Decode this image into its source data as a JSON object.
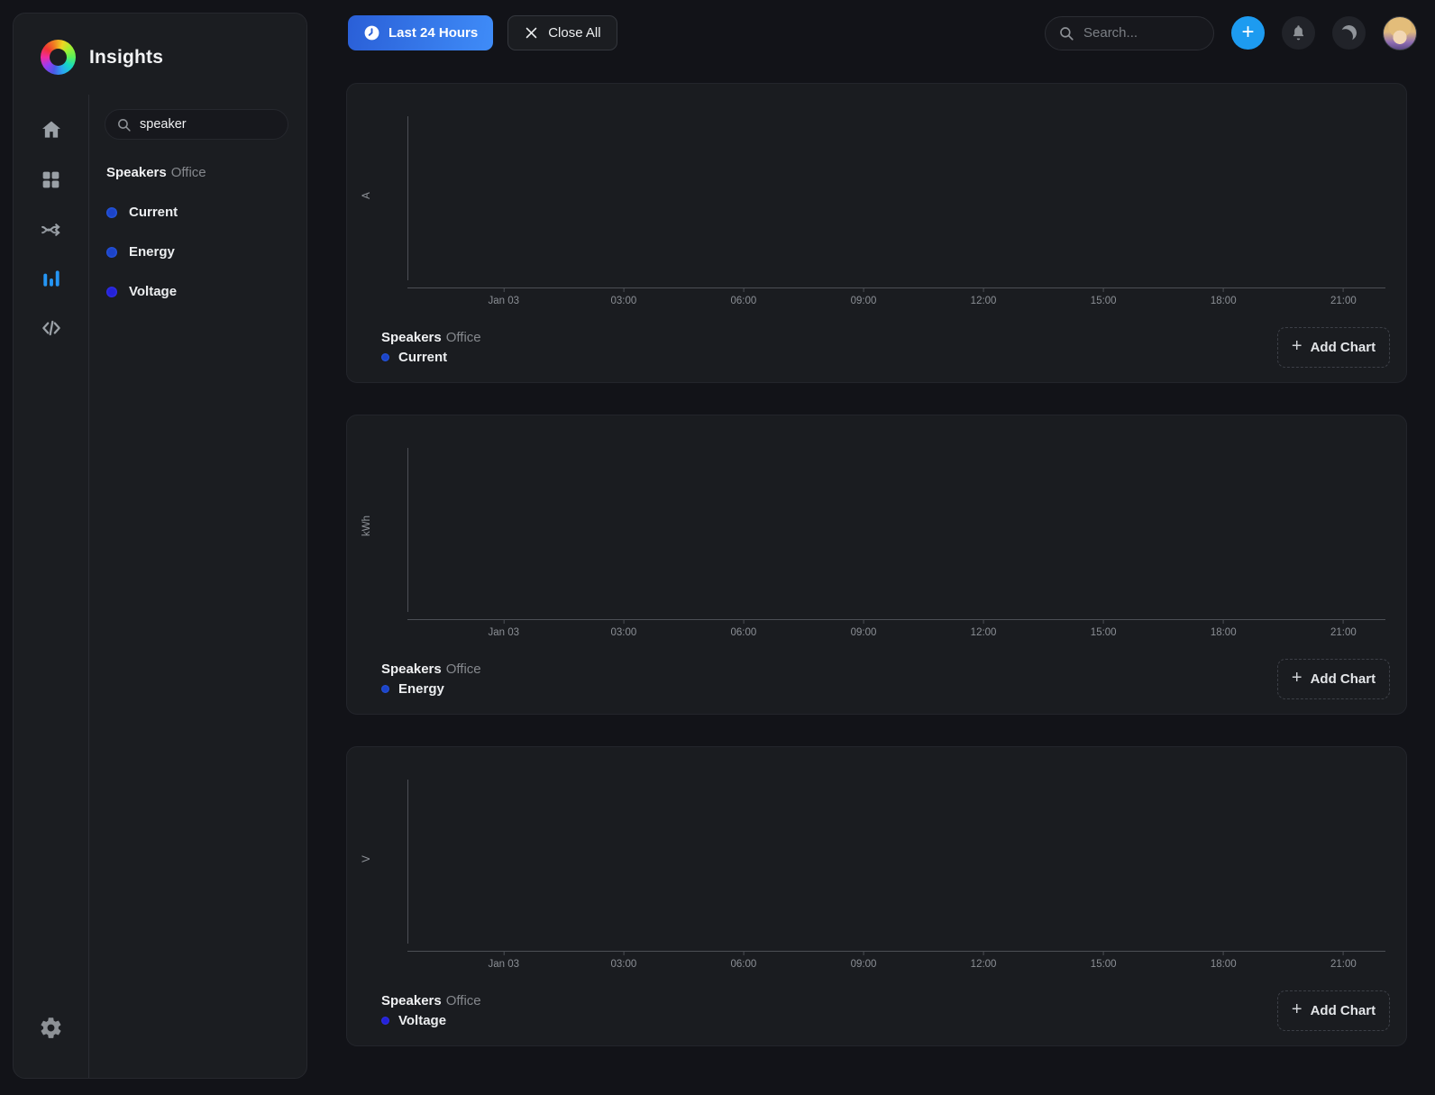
{
  "app": {
    "title": "Insights"
  },
  "colors": {
    "background": "#121318",
    "panel": "#1a1c20",
    "accent_blue": "#3f8cf8",
    "plus_button_blue": "#1d9bf0",
    "active_nav_blue": "#2596f5",
    "entity_blue": "#2e6bf2",
    "voltage_indigo": "#3b3df2",
    "axis_gray": "#4c4f55"
  },
  "sidebar": {
    "search": {
      "value": "speaker"
    },
    "group": {
      "name": "Speakers",
      "location": "Office"
    },
    "items": [
      {
        "label": "Current",
        "color": "#2e6bf2"
      },
      {
        "label": "Energy",
        "color": "#2e62ee"
      },
      {
        "label": "Voltage",
        "color": "#3b3df2"
      }
    ],
    "nav_icons": [
      "home-icon",
      "grid-icon",
      "shuffle-icon",
      "bar-chart-icon",
      "code-icon"
    ],
    "active_nav": "bar-chart-icon",
    "bottom_icon": "gear-icon"
  },
  "topbar": {
    "time_range_label": "Last 24 Hours",
    "close_all_label": "Close All",
    "search_placeholder": "Search...",
    "icons": [
      "plus-icon",
      "bell-icon",
      "moon-icon",
      "avatar"
    ]
  },
  "add_chart_label": "Add Chart",
  "chart_data": [
    {
      "type": "line",
      "title": "Speakers",
      "subtitle": "Office",
      "ylabel": "A",
      "series": [
        {
          "name": "Current",
          "color": "#2e6bf2",
          "values": []
        }
      ],
      "x_ticks": [
        "Jan 03",
        "03:00",
        "06:00",
        "09:00",
        "12:00",
        "15:00",
        "18:00",
        "21:00"
      ],
      "grid": false,
      "legend_position": "bottom-left"
    },
    {
      "type": "line",
      "title": "Speakers",
      "subtitle": "Office",
      "ylabel": "kWh",
      "series": [
        {
          "name": "Energy",
          "color": "#2e62ee",
          "values": []
        }
      ],
      "x_ticks": [
        "Jan 03",
        "03:00",
        "06:00",
        "09:00",
        "12:00",
        "15:00",
        "18:00",
        "21:00"
      ],
      "grid": false,
      "legend_position": "bottom-left"
    },
    {
      "type": "line",
      "title": "Speakers",
      "subtitle": "Office",
      "ylabel": "V",
      "series": [
        {
          "name": "Voltage",
          "color": "#3b3df2",
          "values": []
        }
      ],
      "x_ticks": [
        "Jan 03",
        "03:00",
        "06:00",
        "09:00",
        "12:00",
        "15:00",
        "18:00",
        "21:00"
      ],
      "grid": false,
      "legend_position": "bottom-left"
    }
  ]
}
